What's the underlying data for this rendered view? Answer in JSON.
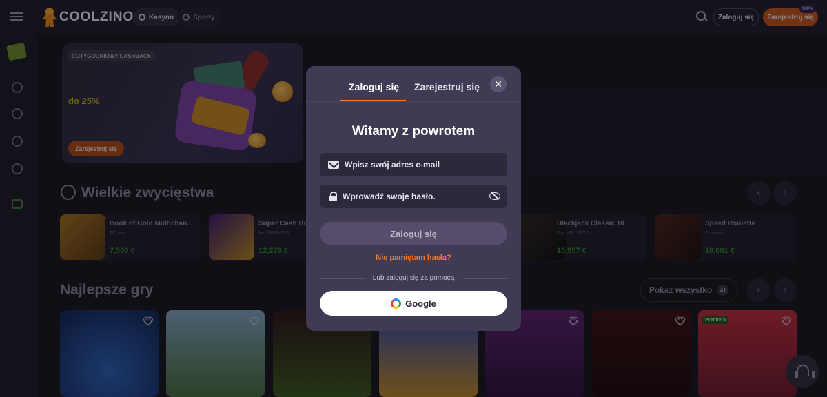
{
  "header": {
    "logo_text": "COOLZINO",
    "nav": [
      {
        "label": "Kasyno"
      },
      {
        "label": "Sporty"
      }
    ],
    "login_label": "Zaloguj się",
    "register_label": "Zarejestruj się",
    "bonus_badge": "100%"
  },
  "promo": {
    "label": "COTYGODNIOWY CASHBACK",
    "percent": "do 25%",
    "button": "Zarejestruj się"
  },
  "big_wins": {
    "title": "Wielkie zwycięstwa",
    "items": [
      {
        "name": "Book of Gold Multichan...",
        "user": "2Chico",
        "amount": "7,500 €"
      },
      {
        "name": "Super Cash Bo",
        "user": "Wolf08284351",
        "amount": "12,278 €"
      },
      {
        "name": "Blackjack Classic 18",
        "user": "Gash18110723",
        "amount": "15,957 €"
      },
      {
        "name": "Speed Roulette",
        "user": "Groovey",
        "amount": "18,001 €"
      }
    ]
  },
  "top_games": {
    "title": "Najlepsze gry",
    "show_all_label": "Pokaż wszystko",
    "count": "41",
    "premiere_label": "Premiera"
  },
  "modal": {
    "tab_login": "Zaloguj się",
    "tab_register": "Zarejestruj się",
    "close": "✕",
    "title": "Witamy z powrotem",
    "email_placeholder": "Wpisz swój adres e-mail",
    "password_placeholder": "Wprowadź swoje hasło.",
    "submit_label": "Zaloguj się",
    "forgot_label": "Nie pamiętam hasła?",
    "divider_text": "Lub zaloguj się za pomocą",
    "google_label": "Google"
  },
  "colors": {
    "accent": "#f27a2c",
    "modal_bg": "#413a55",
    "page_bg": "#16141d",
    "win_green": "#2e8b2e"
  },
  "icons": [
    "menu-icon",
    "search-icon",
    "mail-icon",
    "lock-icon",
    "eye-off-icon",
    "close-icon",
    "google-icon",
    "heart-icon",
    "headset-icon",
    "star-icon",
    "chevron-left-icon",
    "chevron-right-icon"
  ]
}
